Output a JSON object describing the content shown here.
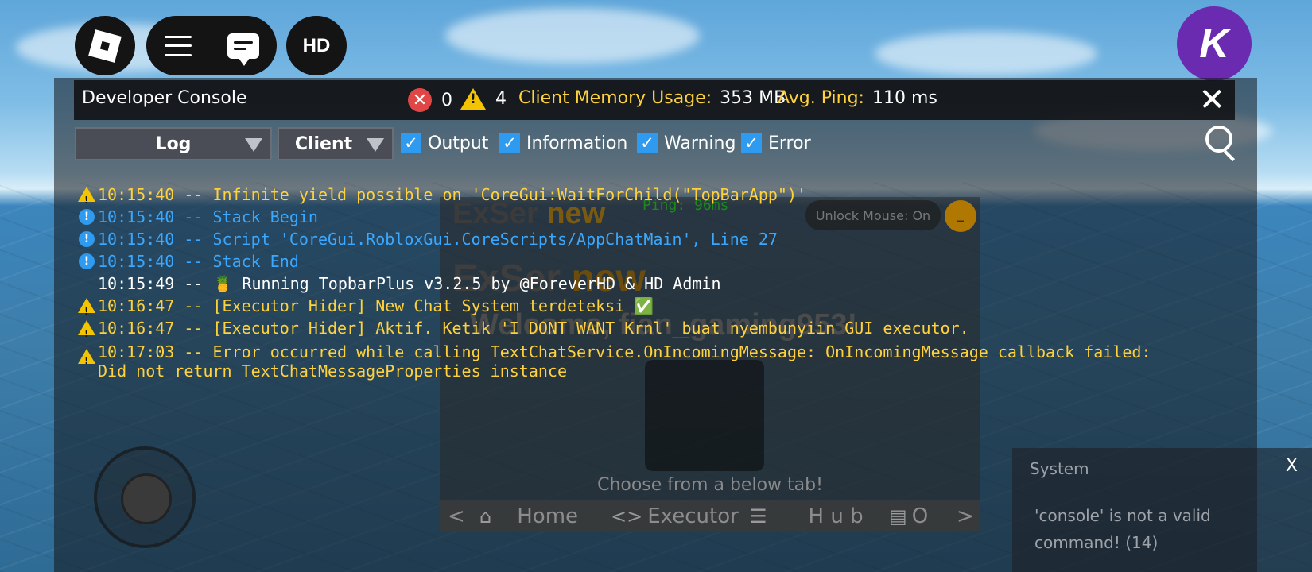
{
  "topbar": {
    "hd_label": "HD",
    "k_label": "K"
  },
  "console": {
    "title": "Developer Console",
    "error_count": "0",
    "warning_count": "4",
    "memory_label": "Client Memory Usage:",
    "memory_value": "353 MB",
    "ping_label": "Avg. Ping:",
    "ping_value": "110 ms",
    "close": "✕",
    "log_dropdown": "Log",
    "client_dropdown": "Client",
    "filters": [
      {
        "label": "Output",
        "checked": true
      },
      {
        "label": "Information",
        "checked": true
      },
      {
        "label": "Warning",
        "checked": true
      },
      {
        "label": "Error",
        "checked": true
      }
    ],
    "entries": [
      {
        "type": "warning",
        "text": "10:15:40 -- Infinite yield possible on 'CoreGui:WaitForChild(\"TopBarApp\")'"
      },
      {
        "type": "info",
        "text": "10:15:40 -- Stack Begin"
      },
      {
        "type": "info",
        "text": "10:15:40 -- Script 'CoreGui.RobloxGui.CoreScripts/AppChatMain', Line 27"
      },
      {
        "type": "info",
        "text": "10:15:40 -- Stack End"
      },
      {
        "type": "output",
        "text": "10:15:49 -- 🍍 Running TopbarPlus v3.2.5 by @ForeverHD & HD Admin"
      },
      {
        "type": "warning",
        "text": "10:16:47 -- [Executor Hider] New Chat System terdeteksi ✅"
      },
      {
        "type": "warning",
        "text": "10:16:47 -- [Executor Hider] Aktif. Ketik 'I DONT WANT Krnl' buat nyembunyiin GUI executor."
      },
      {
        "type": "warning",
        "text": "10:17:03 -- Error occurred while calling TextChatService.OnIncomingMessage: OnIncomingMessage callback failed:\nDid not return TextChatMessageProperties instance"
      }
    ]
  },
  "exser": {
    "title_a": "ExSer",
    "title_b": "new",
    "ping": "Ping: 96ms",
    "unlock": "Unlock Mouse: On",
    "minimize": "_",
    "welcome": "Welcome, fian_gaming953!",
    "choose": "Choose from a below tab!",
    "tab_prev": "<",
    "tab_next": ">",
    "tabs": [
      "Home",
      "Executor",
      "H u b",
      "O"
    ]
  },
  "system": {
    "title": "System",
    "close": "X",
    "message": "'console' is not a valid command! (14)"
  }
}
